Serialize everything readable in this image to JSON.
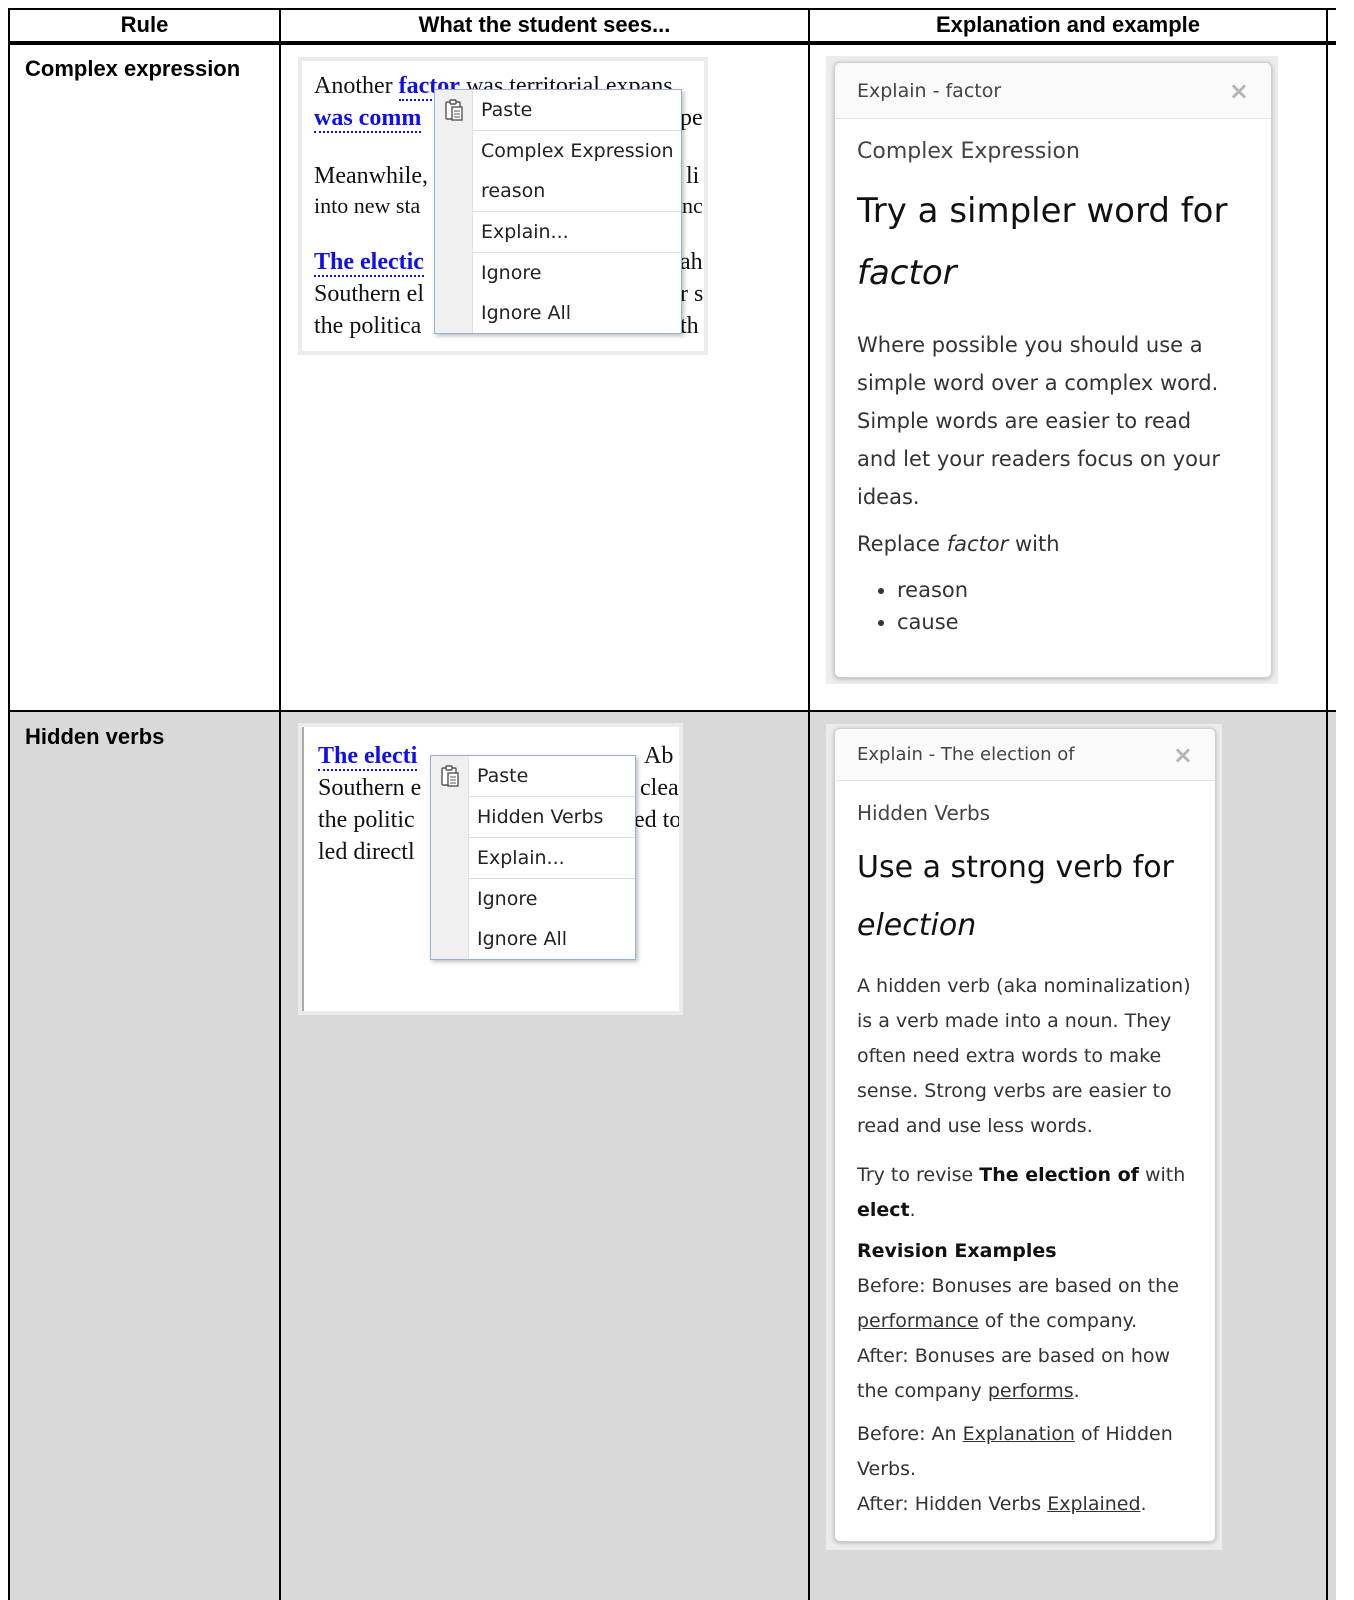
{
  "table": {
    "headers": [
      "Rule",
      "What the student sees...",
      "Explanation and example"
    ]
  },
  "rows": [
    {
      "rule": "Complex expression",
      "student_view": {
        "doc_lines": [
          "Another",
          "factor",
          "was territorial expans",
          "was comm",
          "pe",
          "Meanwhile,",
          "li",
          "into new sta",
          "nc",
          "The electic",
          "ah",
          "Southern el",
          "r s",
          "the politica",
          "th"
        ],
        "menu_items": [
          "Paste",
          "Complex Expression",
          "reason",
          "Explain...",
          "Ignore",
          "Ignore All"
        ],
        "paste_icon": "clipboard-icon"
      },
      "explain": {
        "header": "Explain - factor",
        "close": "×",
        "category": "Complex Expression",
        "heading": "Try a simpler word for",
        "heading_term": "factor",
        "body": [
          "Where possible you should use a",
          "simple word over a complex word.",
          "Simple words are easier to read",
          "and let your readers focus on your",
          "ideas."
        ],
        "replace_prefix": "Replace",
        "replace_term": "factor",
        "replace_suffix": "with",
        "suggestions": [
          "reason",
          "cause"
        ]
      }
    },
    {
      "rule": "Hidden verbs",
      "student_view": {
        "doc_lines": [
          "The electi",
          "Ab",
          "Southern e",
          "clea",
          "the politic",
          "ed to",
          "led directl"
        ],
        "menu_items": [
          "Paste",
          "Hidden Verbs",
          "Explain...",
          "Ignore",
          "Ignore All"
        ],
        "paste_icon": "clipboard-icon"
      },
      "explain": {
        "header": "Explain - The election of",
        "close": "×",
        "category": "Hidden Verbs",
        "heading": "Use a strong verb for",
        "heading_term": "election",
        "body": [
          "A hidden verb (aka nominalization)",
          "is a verb made into a noun. They",
          "often need extra words to make",
          "sense. Strong verbs are easier to",
          "read and use less words."
        ],
        "revise_prefix": "Try to revise",
        "revise_phrase": "The election of",
        "revise_mid": "with",
        "revise_target": "elect",
        "revise_end": ".",
        "examples_title": "Revision Examples",
        "ex1_before_a": "Before: Bonuses are based on the",
        "ex1_before_u": "performance",
        "ex1_before_b": "of the company.",
        "ex1_after_a": "After: Bonuses are based on how",
        "ex1_after_b": "the company",
        "ex1_after_u": "performs",
        "ex1_after_c": ".",
        "ex2_before_a": "Before: An",
        "ex2_before_u": "Explanation",
        "ex2_before_b": "of Hidden",
        "ex2_before_c": "Verbs.",
        "ex2_after_a": "After: Hidden Verbs",
        "ex2_after_u": "Explained",
        "ex2_after_b": "."
      }
    }
  ]
}
